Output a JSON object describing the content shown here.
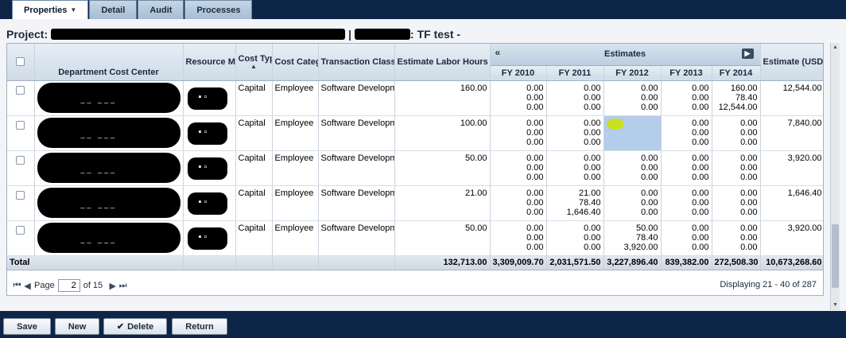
{
  "tabs": [
    {
      "label": "Properties",
      "active": true
    },
    {
      "label": "Detail",
      "active": false
    },
    {
      "label": "Audit",
      "active": false
    },
    {
      "label": "Processes",
      "active": false
    }
  ],
  "project": {
    "prefix": "Project:",
    "suffix": ": TF test -"
  },
  "columns": {
    "dept": "Department Cost Center",
    "resource_manager": "Resource Manager",
    "cost_type": "Cost Type",
    "cost_category": "Cost Category",
    "transaction_class": "Transaction Class",
    "estimate_labor": "Estimate Labor Hours / Non-Labor Dollars",
    "estimates_group": "Estimates",
    "fy": [
      "FY 2010",
      "FY 2011",
      "FY 2012",
      "FY 2013",
      "FY 2014"
    ],
    "estimate_usd": "Estimate (USD)"
  },
  "rows": [
    {
      "cost_type": "Capital",
      "cost_category": "Employee",
      "transaction_class": "Software Development Employee",
      "labor": "160.00",
      "fy": [
        [
          "0.00",
          "0.00",
          "0.00"
        ],
        [
          "0.00",
          "0.00",
          "0.00"
        ],
        [
          "0.00",
          "0.00",
          "0.00"
        ],
        [
          "0.00",
          "0.00",
          "0.00"
        ],
        [
          "160.00",
          "78.40",
          "12,544.00"
        ]
      ],
      "usd": "12,544.00"
    },
    {
      "cost_type": "Capital",
      "cost_category": "Employee",
      "transaction_class": "Software Development Employee",
      "labor": "100.00",
      "fy": [
        [
          "0.00",
          "0.00",
          "0.00"
        ],
        [
          "0.00",
          "0.00",
          "0.00"
        ],
        [
          "",
          "",
          ""
        ],
        [
          "0.00",
          "0.00",
          "0.00"
        ],
        [
          "0.00",
          "0.00",
          "0.00"
        ]
      ],
      "usd": "7,840.00"
    },
    {
      "cost_type": "Capital",
      "cost_category": "Employee",
      "transaction_class": "Software Development Employee",
      "labor": "50.00",
      "fy": [
        [
          "0.00",
          "0.00",
          "0.00"
        ],
        [
          "0.00",
          "0.00",
          "0.00"
        ],
        [
          "0.00",
          "0.00",
          "0.00"
        ],
        [
          "0.00",
          "0.00",
          "0.00"
        ],
        [
          "0.00",
          "0.00",
          "0.00"
        ]
      ],
      "usd": "3,920.00"
    },
    {
      "cost_type": "Capital",
      "cost_category": "Employee",
      "transaction_class": "Software Development Employee",
      "labor": "21.00",
      "fy": [
        [
          "0.00",
          "0.00",
          "0.00"
        ],
        [
          "21.00",
          "78.40",
          "1,646.40"
        ],
        [
          "0.00",
          "0.00",
          "0.00"
        ],
        [
          "0.00",
          "0.00",
          "0.00"
        ],
        [
          "0.00",
          "0.00",
          "0.00"
        ]
      ],
      "usd": "1,646.40"
    },
    {
      "cost_type": "Capital",
      "cost_category": "Employee",
      "transaction_class": "Software Development Employee",
      "labor": "50.00",
      "fy": [
        [
          "0.00",
          "0.00",
          "0.00"
        ],
        [
          "0.00",
          "0.00",
          "0.00"
        ],
        [
          "50.00",
          "78.40",
          "3,920.00"
        ],
        [
          "0.00",
          "0.00",
          "0.00"
        ],
        [
          "0.00",
          "0.00",
          "0.00"
        ]
      ],
      "usd": "3,920.00"
    }
  ],
  "totals": {
    "label": "Total",
    "labor": "132,713.00",
    "fy": [
      "3,309,009.70",
      "2,031,571.50",
      "3,227,896.40",
      "839,382.00",
      "272,508.30"
    ],
    "usd": "10,673,268.60"
  },
  "pager": {
    "page_label": "Page",
    "page": "2",
    "of_label": "of 15",
    "display": "Displaying 21 - 40 of 287"
  },
  "buttons": {
    "save": "Save",
    "new": "New",
    "delete": "Delete",
    "return": "Return"
  },
  "colors": {
    "accent": "#0d2547",
    "selected_cell": "#b3cdea",
    "cursor_highlight": "#c9e021"
  }
}
